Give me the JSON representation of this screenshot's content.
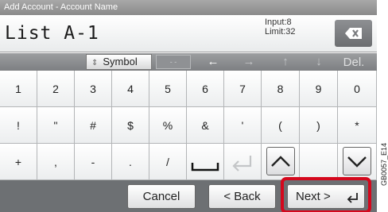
{
  "window": {
    "title": "Add Account - Account Name"
  },
  "entry": {
    "value": "List A-1",
    "input_label": "Input:8",
    "limit_label": "Limit:32",
    "clear_icon": "backspace-x-icon"
  },
  "mode_bar": {
    "symbol_label": "Symbol",
    "dots_label": "- -",
    "left_arrow": "←",
    "right_arrow": "→",
    "up_arrow": "↑",
    "down_arrow": "↓",
    "delete_label": "Del."
  },
  "keys": {
    "row1": [
      "1",
      "2",
      "3",
      "4",
      "5",
      "6",
      "7",
      "8",
      "9",
      "0"
    ],
    "row2": [
      "!",
      "\"",
      "#",
      "$",
      "%",
      "&",
      "'",
      "(",
      ")",
      "*"
    ],
    "row3": [
      "+",
      ",",
      "-",
      ".",
      "/"
    ],
    "row3_icons": [
      "space-icon",
      "enter-icon",
      "page-up-icon",
      "page-down-icon"
    ]
  },
  "footer": {
    "cancel_label": "Cancel",
    "back_label": "< Back",
    "next_label": "Next >"
  },
  "side_code": "GB0057_E14",
  "colors": {
    "highlight": "#d4081d",
    "bar": "#6d7073"
  }
}
